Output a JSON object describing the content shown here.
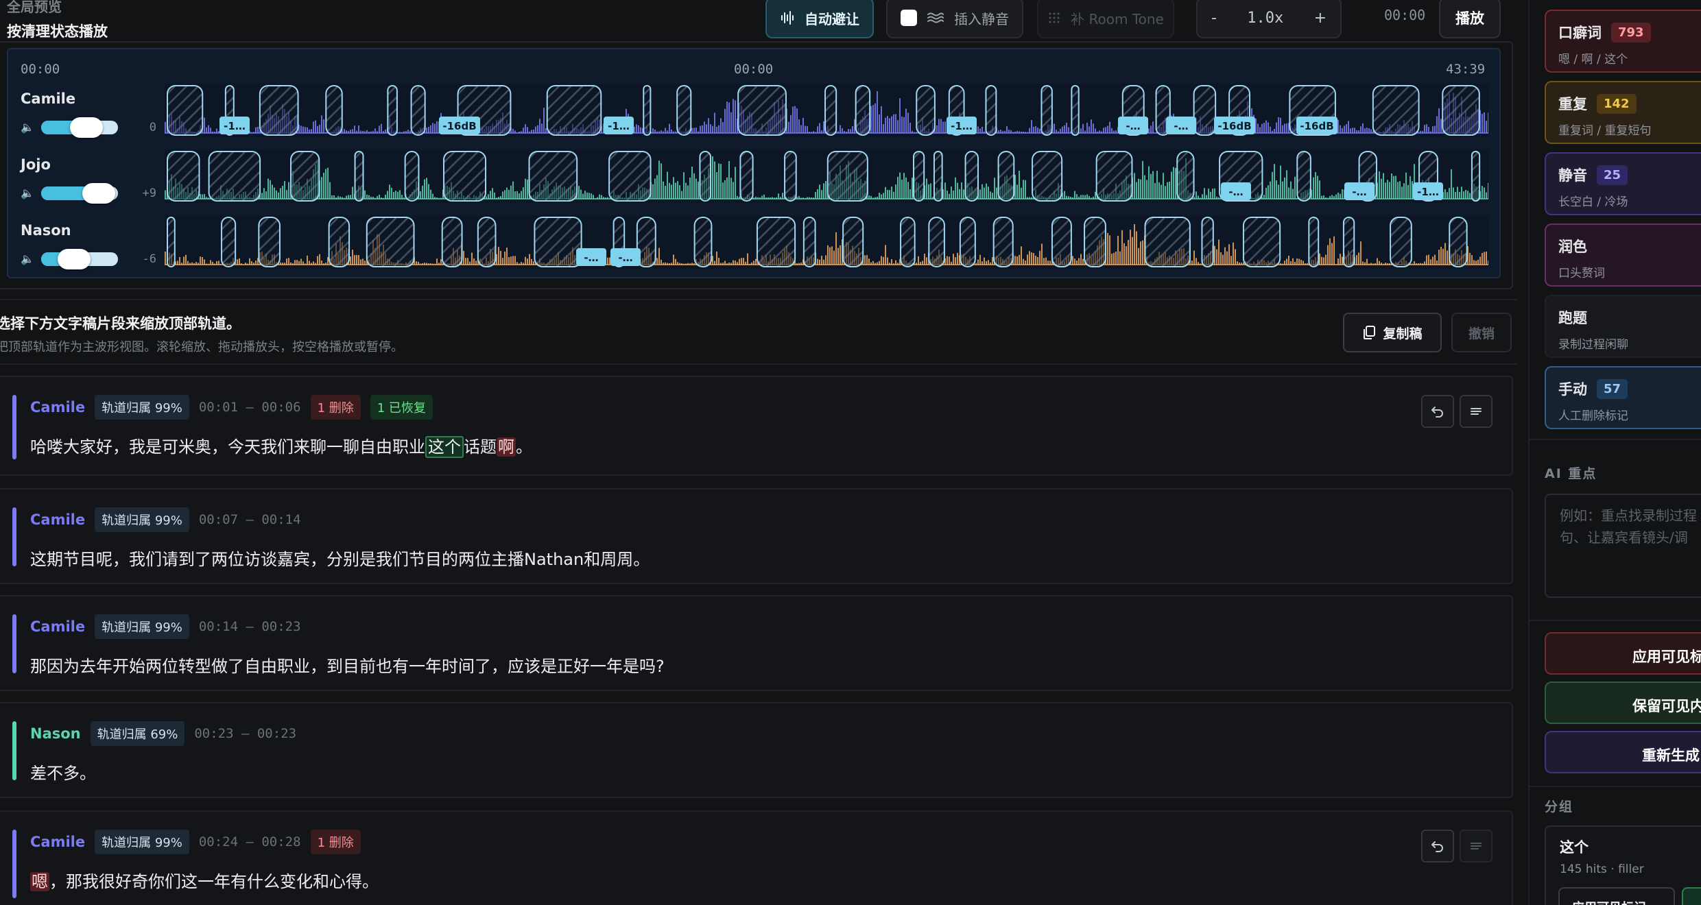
{
  "toolbar": {
    "preview_label": "全局预览",
    "preview_title": "按清理状态播放",
    "auto_duck_label": "自动避让",
    "insert_silence_label": "插入静音",
    "room_tone_label": "补 Room Tone",
    "speed_minus": "-",
    "speed_value": "1.0x",
    "speed_plus": "+",
    "current_time": "00:00",
    "play_label": "播放"
  },
  "timeline": {
    "start": "00:00",
    "playhead": "00:00",
    "end": "43:39",
    "tracks": [
      {
        "name": "Camile",
        "gain": "0",
        "color": "#7b7cf5",
        "volume": 0.62,
        "badges": [
          "-1…",
          "-16dB",
          "-1…",
          "-1…",
          "-…",
          "-…",
          "-16dB",
          "-16dB"
        ]
      },
      {
        "name": "Jojo",
        "gain": "+9",
        "color": "#59d4b4",
        "volume": 0.78,
        "badges": [
          "-…",
          "-…",
          "-1…"
        ]
      },
      {
        "name": "Nason",
        "gain": "-6",
        "color": "#f0a95a",
        "volume": 0.5,
        "badges": [
          "-…",
          "-…"
        ]
      }
    ]
  },
  "infobar": {
    "title": "选择下方文字稿片段来缩放顶部轨道。",
    "subtitle": "把顶部轨道作为主波形视图。滚轮缩放、拖动播放头，按空格播放或暂停。",
    "copy_label": "复制稿",
    "undo_label": "撤销"
  },
  "segments": [
    {
      "speaker": "Camile",
      "color": "#7b7cf5",
      "owner_tag": "轨道归属 99%",
      "time": "00:01 — 00:06",
      "deleted_tag": "1 删除",
      "restored_tag": "1 已恢复",
      "text_a": "哈喽大家好，我是可米奥，今天我们来聊一聊自由职业",
      "hl_green": "这个",
      "text_b": "话题",
      "hl_red": "啊",
      "text_c": "。"
    },
    {
      "speaker": "Camile",
      "color": "#7b7cf5",
      "owner_tag": "轨道归属 99%",
      "time": "00:07 — 00:14",
      "text": "这期节目呢，我们请到了两位访谈嘉宾，分别是我们节目的两位主播Nathan和周周。"
    },
    {
      "speaker": "Camile",
      "color": "#7b7cf5",
      "owner_tag": "轨道归属 99%",
      "time": "00:14 — 00:23",
      "text": "那因为去年开始两位转型做了自由职业，到目前也有一年时间了，应该是正好一年是吗?"
    },
    {
      "speaker": "Nason",
      "color": "#59d4b4",
      "owner_tag": "轨道归属 69%",
      "time": "00:23 — 00:23",
      "text": "差不多。"
    },
    {
      "speaker": "Camile",
      "color": "#7b7cf5",
      "owner_tag": "轨道归属 99%",
      "time": "00:24 — 00:28",
      "deleted_tag": "1 删除",
      "hl_red": "嗯",
      "text": "，那我很好奇你们这一年有什么变化和心得。"
    }
  ],
  "sidebar": {
    "categories": [
      {
        "title": "口癖词",
        "count": "793",
        "sub": "嗯 / 啊 / 这个",
        "accent": "#e0474f"
      },
      {
        "title": "重复",
        "count": "142",
        "sub": "重复词 / 重复短句",
        "accent": "#d9a321"
      },
      {
        "title": "静音",
        "count": "25",
        "sub": "长空白 / 冷场",
        "accent": "#6b5fd8"
      },
      {
        "title": "润色",
        "count": "",
        "sub": "口头赘词",
        "accent": "#b04aa6"
      },
      {
        "title": "跑题",
        "count": "",
        "sub": "录制过程闲聊",
        "accent": "#2f3136"
      },
      {
        "title": "手动",
        "count": "57",
        "sub": "人工删除标记",
        "accent": "#3d84c8"
      }
    ],
    "ai_label": "AI 重点",
    "ai_placeholder_line1": "例如：重点找录制过程",
    "ai_placeholder_line2": "句、让嘉宾看镜头/调",
    "apply_visible_label": "应用可见标",
    "keep_visible_label": "保留可见内",
    "regenerate_label": "重新生成",
    "group_label": "分组",
    "group_title": "这个",
    "group_sub": "145 hits · filler",
    "group_apply_label": "应用可见标记"
  }
}
